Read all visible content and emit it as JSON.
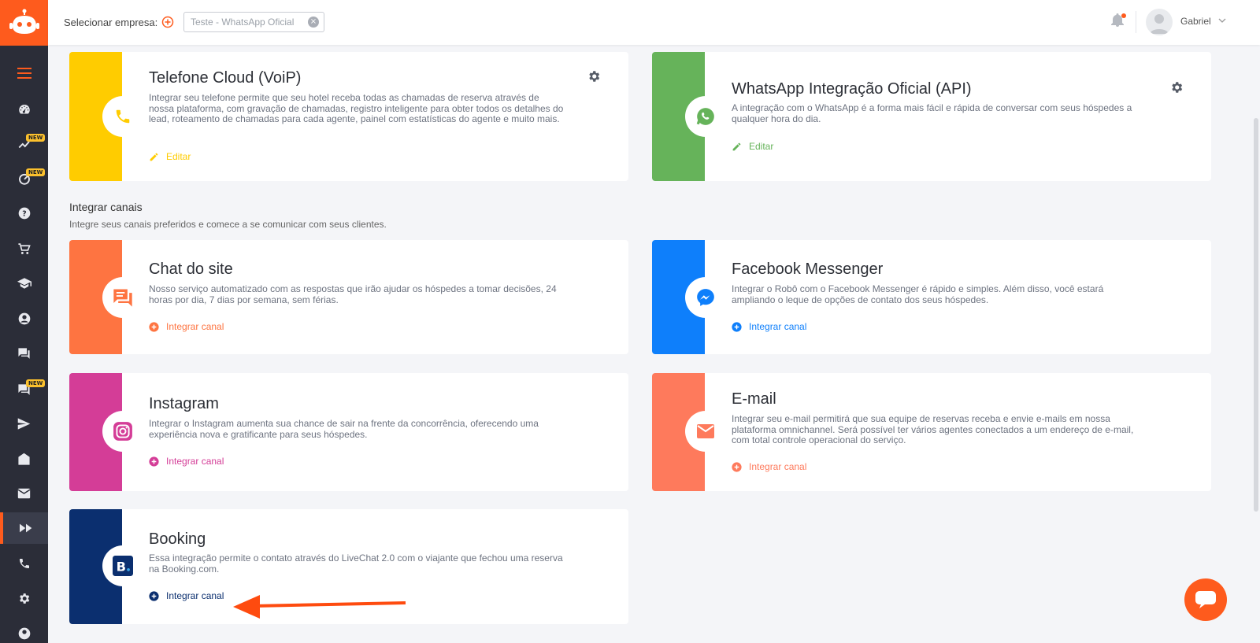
{
  "topbar": {
    "company_label": "Selecionar empresa:",
    "company_value": "Teste - WhatsApp Oficial",
    "username": "Gabriel"
  },
  "sidebar": {
    "items": [
      {
        "icon": "menu-icon"
      },
      {
        "icon": "dashboard-icon"
      },
      {
        "icon": "trend-icon",
        "badge": "NEW"
      },
      {
        "icon": "speedometer-icon",
        "badge": "NEW"
      },
      {
        "icon": "help-icon"
      },
      {
        "icon": "cart-icon"
      },
      {
        "icon": "school-icon"
      },
      {
        "icon": "account-icon"
      },
      {
        "icon": "forum-icon"
      },
      {
        "icon": "chat-icon",
        "badge": "NEW"
      },
      {
        "icon": "send-icon"
      },
      {
        "icon": "drafts-icon"
      },
      {
        "icon": "mail-icon"
      },
      {
        "icon": "fast-forward-icon"
      },
      {
        "icon": "phone-icon"
      },
      {
        "icon": "settings-icon"
      }
    ]
  },
  "cards": {
    "voip": {
      "title": "Telefone Cloud (VoiP)",
      "desc": "Integrar seu telefone permite que seu hotel receba todas as chamadas de reserva através de nossa plataforma, com gravação de chamadas, registro inteligente para obter todos os detalhes do lead, roteamento de chamadas para cada agente, painel com estatísticas do agente e muito mais.",
      "action": "Editar",
      "color": "#ffcc00"
    },
    "whatsapp": {
      "title": "WhatsApp Integração Oficial (API)",
      "desc": "A integração com o WhatsApp é a forma mais fácil e rápida de conversar com seus hóspedes a qualquer hora do dia.",
      "action": "Editar",
      "color": "#66b35a"
    },
    "chat": {
      "title": "Chat do site",
      "desc": "Nosso serviço automatizado com as respostas que irão ajudar os hóspedes a tomar decisões, 24 horas por dia, 7 dias por semana, sem férias.",
      "action": "Integrar canal",
      "color": "#fe7441"
    },
    "messenger": {
      "title": "Facebook Messenger",
      "desc": "Integrar o Robô com o Facebook Messenger é rápido e simples. Além disso, você estará ampliando o leque de opções de contato dos seus hóspedes.",
      "action": "Integrar canal",
      "color": "#0e7ffb"
    },
    "instagram": {
      "title": "Instagram",
      "desc": "Integrar o Instagram aumenta sua chance de sair na frente da concorrência, oferecendo uma experiência nova e gratificante para seus hóspedes.",
      "action": "Integrar canal",
      "color": "#d43d97"
    },
    "email": {
      "title": "E-mail",
      "desc": "Integrar seu e-mail permitirá que sua equipe de reservas receba e envie e-mails em nossa plataforma omnichannel. Será possível ter vários agentes conectados a um endereço de e-mail, com total controle operacional do serviço.",
      "action": "Integrar canal",
      "color": "#fe7a5c"
    },
    "booking": {
      "title": "Booking",
      "desc": "Essa integração permite o contato através do LiveChat 2.0 com o viajante que fechou uma reserva na Booking.com.",
      "action": "Integrar canal",
      "color": "#0b2f6f"
    }
  },
  "section": {
    "title": "Integrar canais",
    "subtitle": "Integre seus canais preferidos e comece a se comunicar com seus clientes."
  }
}
